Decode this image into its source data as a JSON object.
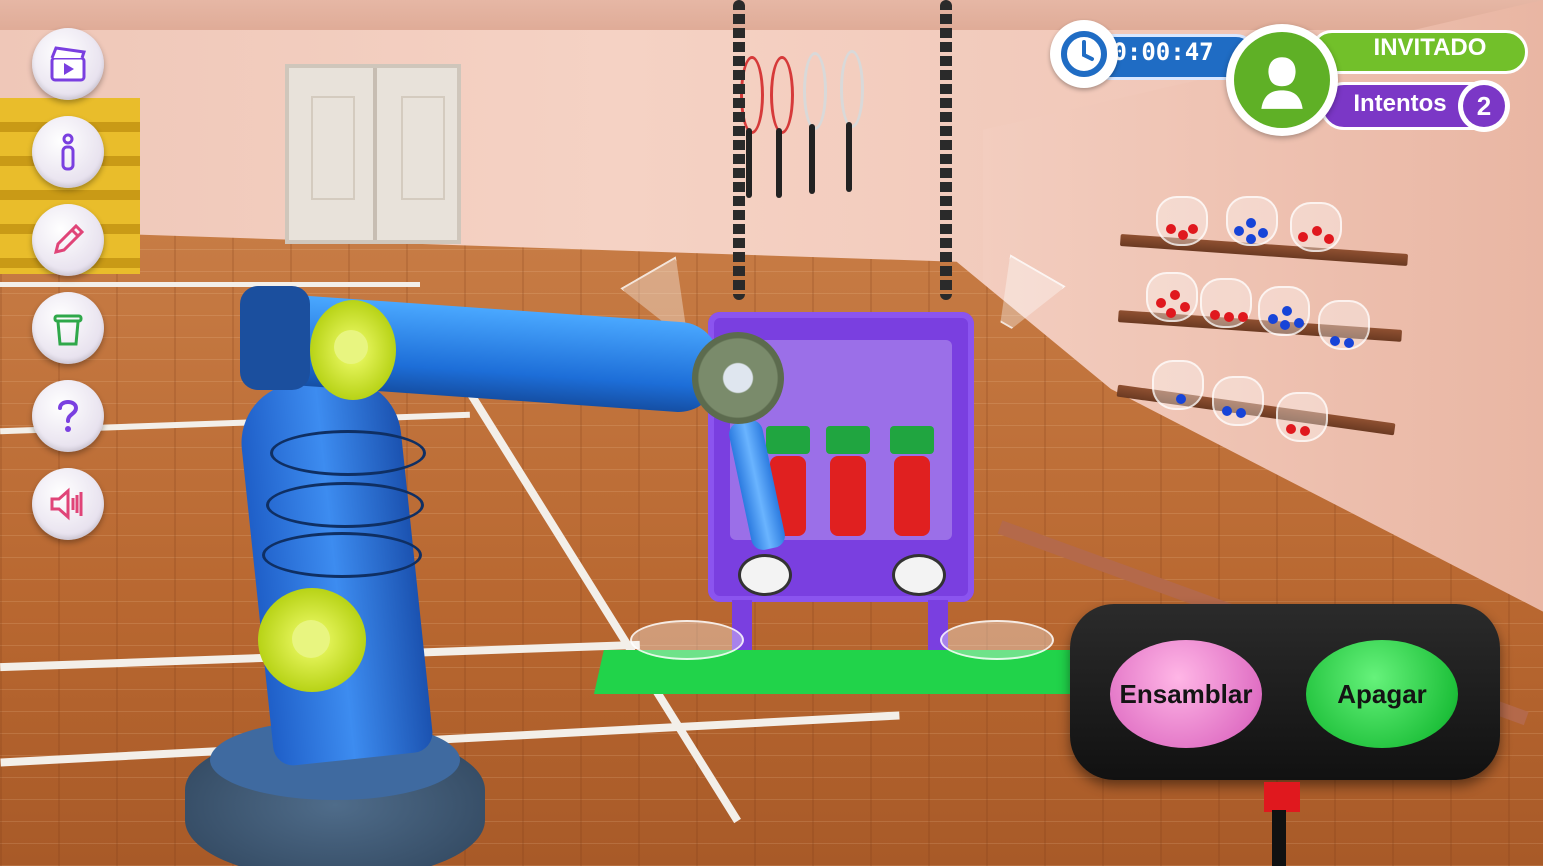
{
  "sidebar": {
    "buttons": [
      {
        "id": "video",
        "icon": "video-clapper-icon"
      },
      {
        "id": "info",
        "icon": "info-icon"
      },
      {
        "id": "notes",
        "icon": "pencil-icon"
      },
      {
        "id": "trash",
        "icon": "trash-icon"
      },
      {
        "id": "help",
        "icon": "question-icon"
      },
      {
        "id": "sound",
        "icon": "speaker-icon"
      }
    ]
  },
  "hud": {
    "timer": "00:00:47",
    "user": "INVITADO",
    "tries_label": "Intentos",
    "tries_count": "2",
    "colors": {
      "timer": "#1f6cc4",
      "user": "#72c02a",
      "tries": "#7b37c6"
    }
  },
  "controls": {
    "assemble_label": "Ensamblar",
    "off_label": "Apagar",
    "colors": {
      "assemble": "#e070c4",
      "off": "#1ec03a"
    }
  }
}
